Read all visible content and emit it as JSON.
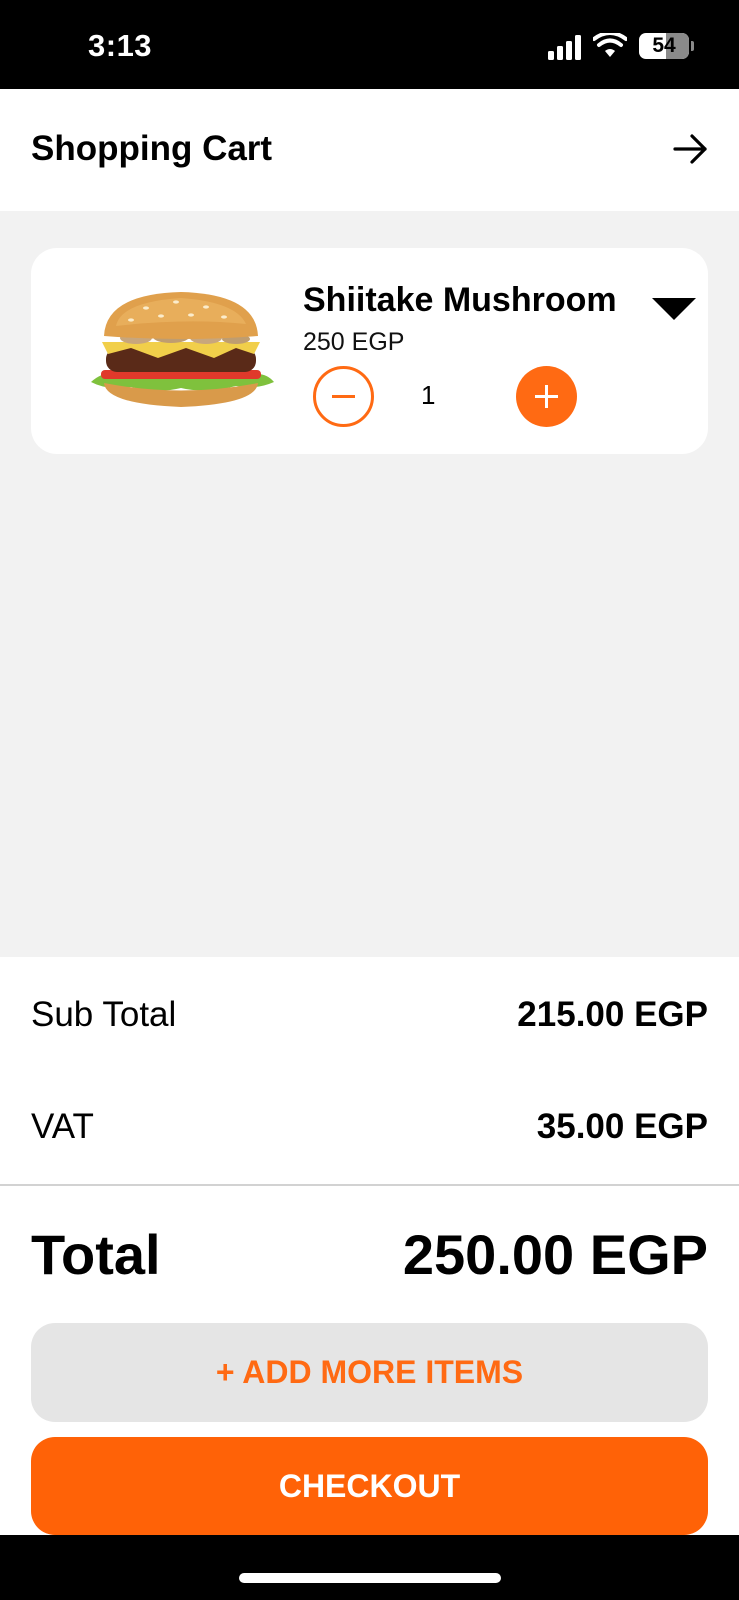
{
  "status_bar": {
    "time": "3:13",
    "battery": "54"
  },
  "header": {
    "title": "Shopping Cart",
    "action_icon": "arrow-right-icon"
  },
  "cart": {
    "items": [
      {
        "name": "Shiitake Mushroom",
        "price": "250 EGP",
        "quantity": "1",
        "image_icon": "burger-image"
      }
    ]
  },
  "summary": {
    "subtotal_label": "Sub Total",
    "subtotal_value": "215.00 EGP",
    "vat_label": "VAT",
    "vat_value": "35.00 EGP",
    "total_label": "Total",
    "total_value": "250.00 EGP"
  },
  "actions": {
    "add_more_label": "+ ADD MORE ITEMS",
    "checkout_label": "CHECKOUT"
  },
  "colors": {
    "accent": "#ff6a13",
    "button_gray": "#e5e5e5",
    "background": "#f2f2f2"
  }
}
